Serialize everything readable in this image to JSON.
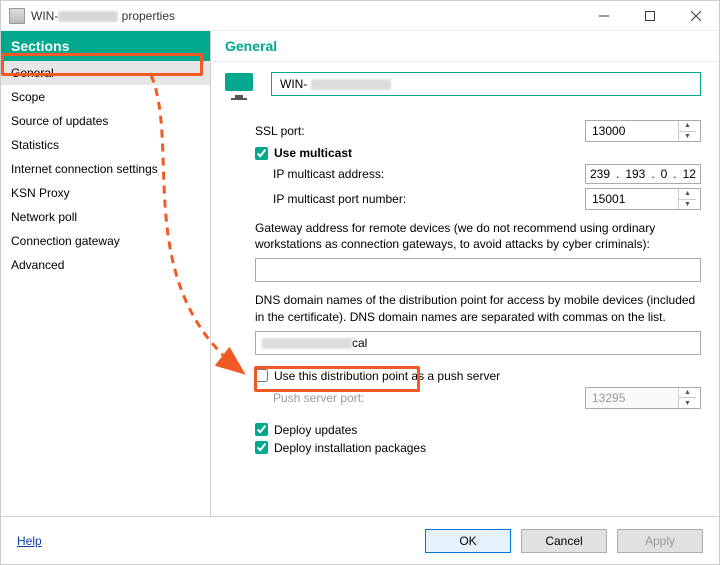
{
  "window": {
    "title_prefix": "WIN-",
    "title_suffix": " properties"
  },
  "sidebar": {
    "header": "Sections",
    "items": [
      {
        "label": "General",
        "selected": true
      },
      {
        "label": "Scope"
      },
      {
        "label": "Source of updates"
      },
      {
        "label": "Statistics"
      },
      {
        "label": "Internet connection settings"
      },
      {
        "label": "KSN Proxy"
      },
      {
        "label": "Network poll"
      },
      {
        "label": "Connection gateway"
      },
      {
        "label": "Advanced"
      }
    ]
  },
  "main": {
    "header": "General",
    "hostname_prefix": "WIN-",
    "ssl_port_label": "SSL port:",
    "ssl_port_value": "13000",
    "use_multicast_label": "Use multicast",
    "use_multicast_checked": true,
    "ip_multicast_address_label": "IP multicast address:",
    "ip_multicast_address_value": [
      "239",
      "193",
      "0",
      "12"
    ],
    "ip_multicast_port_label": "IP multicast port number:",
    "ip_multicast_port_value": "15001",
    "gateway_desc": "Gateway address for remote devices (we do not recommend using ordinary workstations as connection gateways, to avoid attacks by cyber criminals):",
    "gateway_value": "",
    "dns_desc": "DNS domain names of the distribution point for access by mobile devices (included in the certificate). DNS domain names are separated with commas on the list.",
    "dns_value_suffix": "cal",
    "push_server_label": "Use this distribution point as a push server",
    "push_server_checked": false,
    "push_port_label": "Push server port:",
    "push_port_value": "13295",
    "deploy_updates_label": "Deploy updates",
    "deploy_updates_checked": true,
    "deploy_packages_label": "Deploy installation packages",
    "deploy_packages_checked": true
  },
  "footer": {
    "help": "Help",
    "ok": "OK",
    "cancel": "Cancel",
    "apply": "Apply"
  }
}
